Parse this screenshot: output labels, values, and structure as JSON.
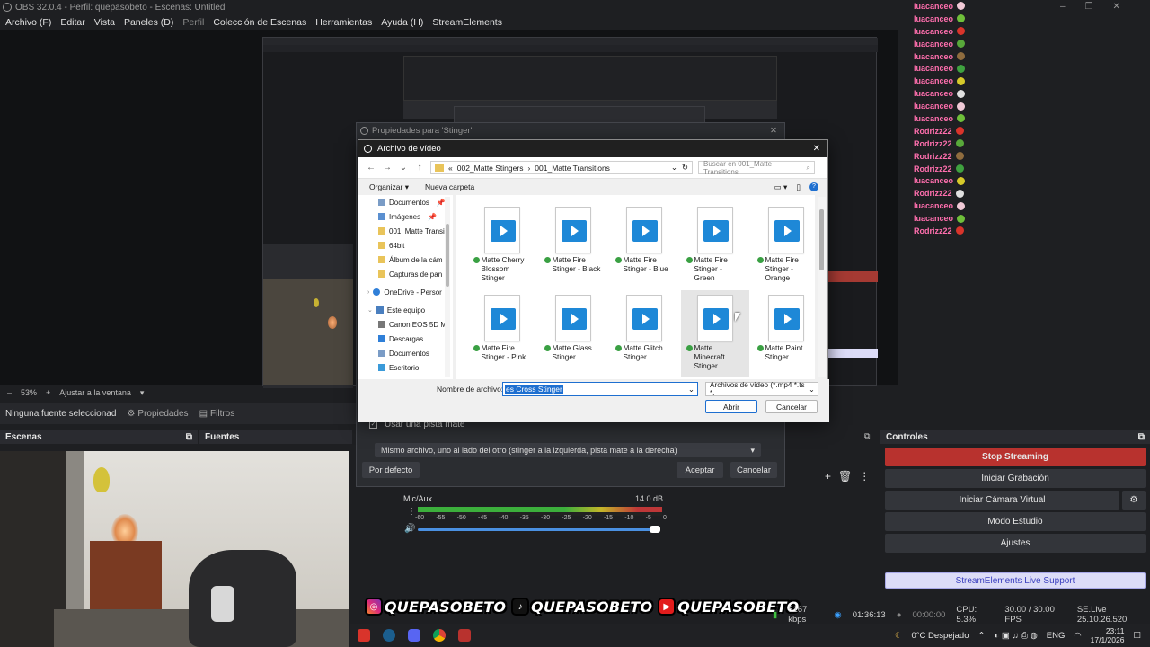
{
  "window": {
    "title": "OBS 32.0.4 - Perfil: quepasobeto - Escenas: Untitled"
  },
  "menu": {
    "items": [
      "Archivo (F)",
      "Editar",
      "Vista",
      "Paneles (D)",
      "Perfil",
      "Colección de Escenas",
      "Herramientas",
      "Ayuda (H)",
      "StreamElements"
    ]
  },
  "preview": {
    "zoom": "53%",
    "fit": "Ajustar a la ventana"
  },
  "source_bar": {
    "no_source": "Ninguna fuente seleccionad",
    "properties": "Propiedades",
    "filters": "Filtros"
  },
  "docks": {
    "scenes": "Escenas",
    "sources": "Fuentes",
    "controls": "Controles"
  },
  "audio": {
    "name": "Mic/Aux",
    "db": "14.0 dB",
    "scale": [
      "-60",
      "-55",
      "-50",
      "-45",
      "-40",
      "-35",
      "-30",
      "-25",
      "-20",
      "-15",
      "-10",
      "-5",
      "0"
    ]
  },
  "controls": {
    "stop_streaming": "Stop Streaming",
    "start_recording": "Iniciar Grabación",
    "virtual_cam": "Iniciar Cámara Virtual",
    "studio_mode": "Modo Estudio",
    "settings": "Ajustes",
    "support": "StreamElements Live Support"
  },
  "status": {
    "kbps": "5167 kbps",
    "live_time": "01:36:13",
    "rec_time": "00:00:00",
    "cpu": "CPU: 5.3%",
    "fps": "30.00 / 30.00 FPS",
    "version": "SE.Live 25.10.26.520"
  },
  "taskbar": {
    "weather": "0°C Despejado",
    "lang": "ENG",
    "time": "23:11",
    "date": "17/1/2026"
  },
  "chat": {
    "lines": [
      {
        "user": "luacanceo",
        "color": "#ff6fae"
      },
      {
        "user": "luacanceo",
        "color": "#ff6fae"
      },
      {
        "user": "luacanceo",
        "color": "#ff6fae"
      },
      {
        "user": "luacanceo",
        "color": "#ff6fae"
      },
      {
        "user": "luacanceo",
        "color": "#ff6fae"
      },
      {
        "user": "luacanceo",
        "color": "#ff6fae"
      },
      {
        "user": "luacanceo",
        "color": "#ff6fae"
      },
      {
        "user": "luacanceo",
        "color": "#ff6fae"
      },
      {
        "user": "luacanceo",
        "color": "#ff6fae"
      },
      {
        "user": "luacanceo",
        "color": "#ff6fae"
      },
      {
        "user": "Rodrizz22",
        "color": "#ff6fae"
      },
      {
        "user": "Rodrizz22",
        "color": "#ff6fae"
      },
      {
        "user": "Rodrizz22",
        "color": "#ff6fae"
      },
      {
        "user": "Rodrizz22",
        "color": "#ff6fae"
      },
      {
        "user": "luacanceo",
        "color": "#ff6fae"
      },
      {
        "user": "Rodrizz22",
        "color": "#ff6fae"
      },
      {
        "user": "luacanceo",
        "color": "#ff6fae"
      },
      {
        "user": "luacanceo",
        "color": "#ff6fae"
      },
      {
        "user": "Rodrizz22",
        "color": "#ff6fae"
      }
    ]
  },
  "props_dialog": {
    "title": "Propiedades para 'Stinger'",
    "matte_label": "Usar una pista mate",
    "matte_mode": "Mismo archivo, uno al lado del otro (stinger a la izquierda, pista mate a la derecha)",
    "defaults": "Por defecto",
    "accept": "Aceptar",
    "cancel": "Cancelar"
  },
  "file_dialog": {
    "title": "Archivo de vídeo",
    "path": [
      "002_Matte Stingers",
      "001_Matte Transitions"
    ],
    "search_placeholder": "Buscar en 001_Matte Transitions",
    "organize": "Organizar",
    "new_folder": "Nueva carpeta",
    "nav": [
      "Documentos",
      "Imágenes",
      "001_Matte Transi",
      "64bit",
      "Álbum de la cám",
      "Capturas de pan",
      "OneDrive - Persor",
      "Este equipo",
      "Canon EOS 5D M",
      "Descargas",
      "Documentos",
      "Escritorio"
    ],
    "files": [
      "Matte Cherry Blossom Stinger",
      "Matte Fire Stinger - Black",
      "Matte Fire Stinger - Blue",
      "Matte Fire Stinger - Green",
      "Matte Fire Stinger - Orange",
      "Matte Fire Stinger - Pink",
      "Matte Glass Stinger",
      "Matte Glitch Stinger",
      "Matte Minecraft Stinger",
      "Matte Paint Stinger"
    ],
    "filename_label": "Nombre de archivo:",
    "filename_value": "es Cross Stinger",
    "filter": "Archivos de vídeo (*.mp4 *.ts *.",
    "open": "Abrir",
    "cancel": "Cancelar"
  },
  "overlay": {
    "handle": "QUEPASOBETO"
  },
  "colors": {
    "stop_streaming": "#b8322e",
    "support_bg": "#dcdcf7",
    "accent": "#1e88d7"
  }
}
